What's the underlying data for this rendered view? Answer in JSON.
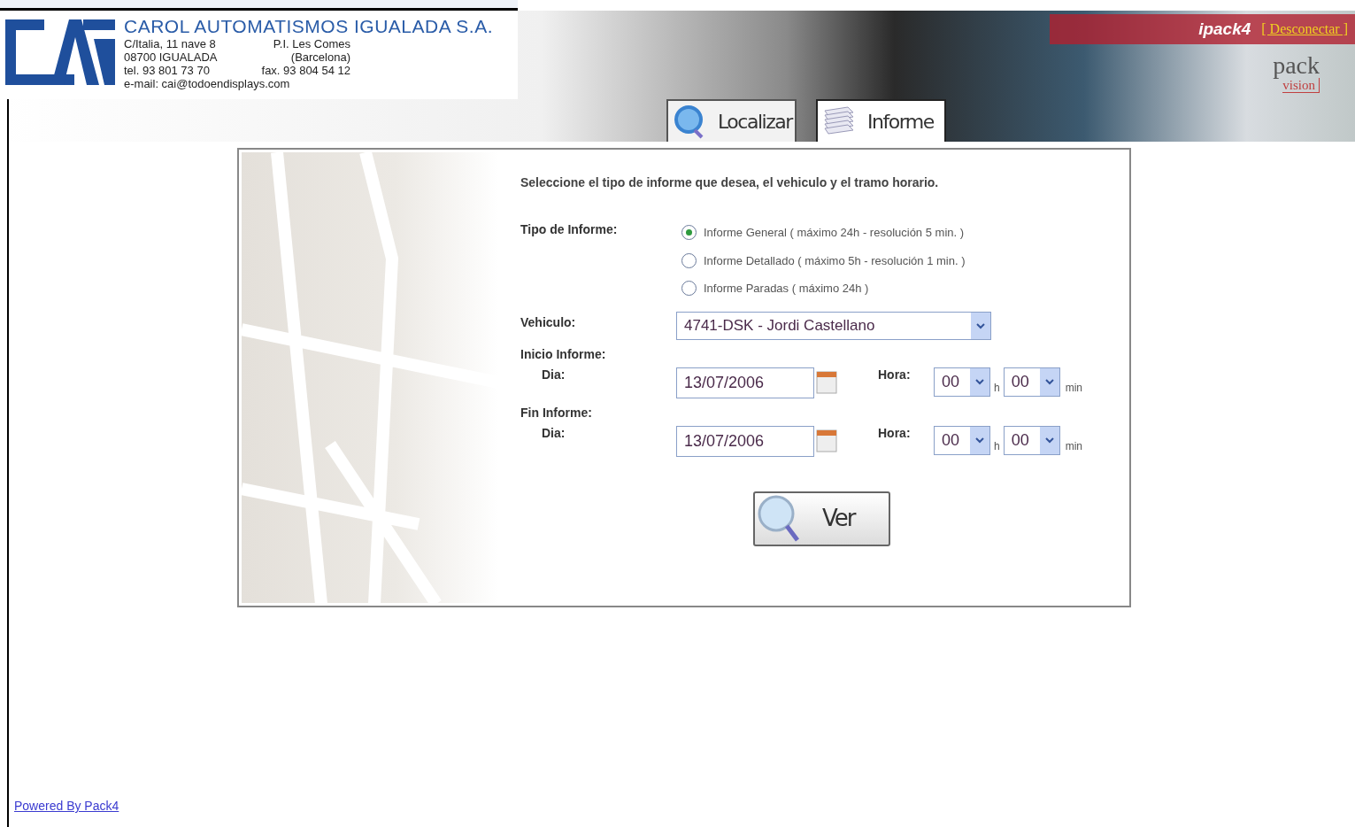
{
  "company": {
    "name": "CAROL AUTOMATISMOS IGUALADA S.A.",
    "address_lines": [
      [
        "C/Italia, 11 nave 8",
        "P.I. Les Comes"
      ],
      [
        "08700 IGUALADA",
        "(Barcelona)"
      ],
      [
        "tel. 93 801 73 70",
        "fax. 93 804 54 12"
      ]
    ],
    "email": "e-mail: cai@todoendisplays.com"
  },
  "product": {
    "name": "ipack4",
    "disconnect": "[ Desconectar ]",
    "logo_main": "pack",
    "logo_sub": "vision"
  },
  "tabs": [
    {
      "label": "Localizar",
      "kind": "locate",
      "selected": false
    },
    {
      "label": "Informe",
      "kind": "report",
      "selected": true
    }
  ],
  "form": {
    "intro": "Seleccione el tipo de informe que desea, el vehiculo y el tramo horario.",
    "type_label": "Tipo de Informe:",
    "report_types": [
      {
        "label": "Informe General ( máximo 24h - resolución 5 min. )",
        "selected": true
      },
      {
        "label": "Informe Detallado ( máximo 5h - resolución 1 min. )",
        "selected": false
      },
      {
        "label": "Informe Paradas ( máximo 24h )",
        "selected": false
      }
    ],
    "vehicle_label": "Vehiculo:",
    "vehicle": "4741-DSK - Jordi Castellano",
    "periods": [
      {
        "title": "Inicio Informe:",
        "day_label": "Dia:",
        "date": "13/07/2006",
        "hour_label": "Hora:",
        "hour": "00",
        "hour_unit": "h",
        "minute": "00",
        "minute_unit": "min"
      },
      {
        "title": "Fin Informe:",
        "day_label": "Dia:",
        "date": "13/07/2006",
        "hour_label": "Hora:",
        "hour": "00",
        "hour_unit": "h",
        "minute": "00",
        "minute_unit": "min"
      }
    ],
    "submit": "Ver"
  },
  "footer_link": "Powered By Pack4"
}
